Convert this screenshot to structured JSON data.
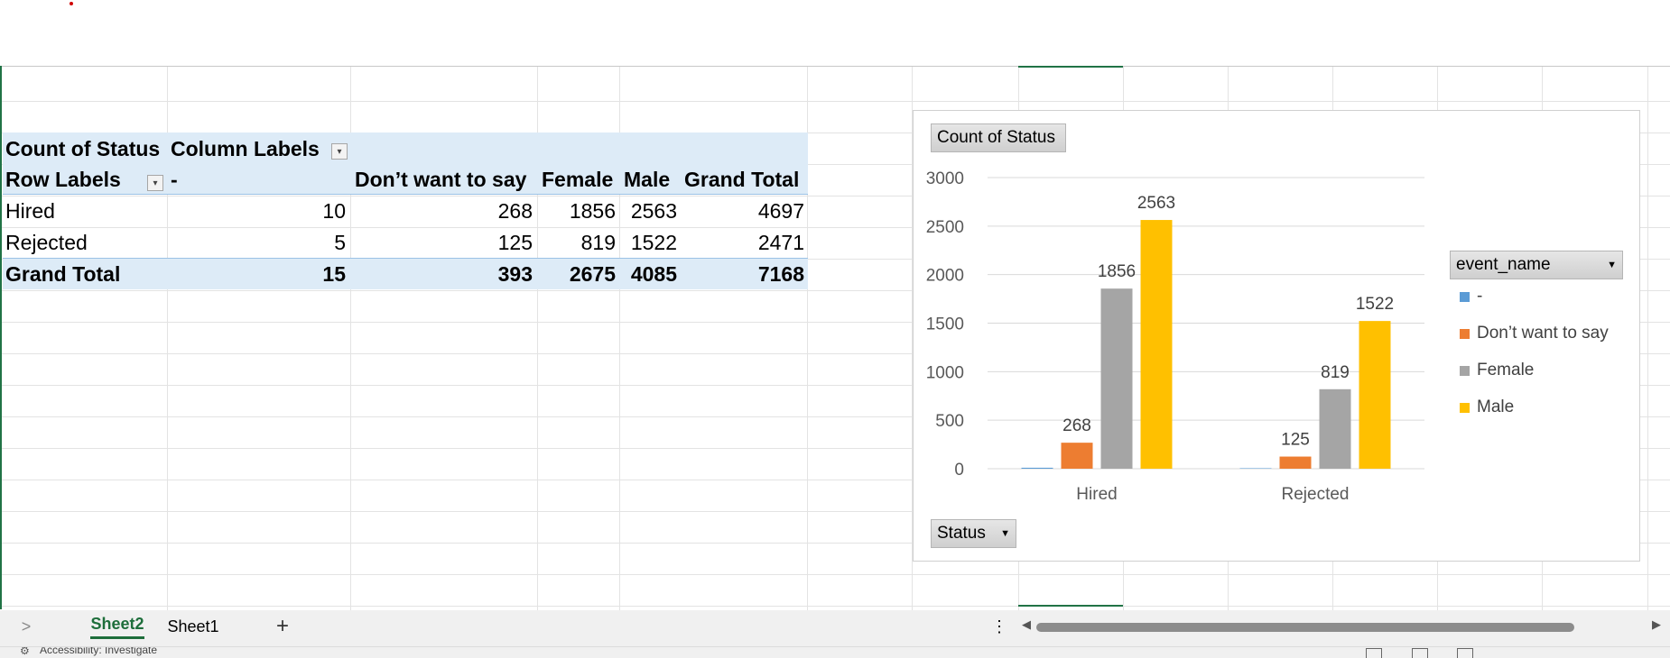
{
  "pivot": {
    "header_row1": {
      "c1": "Count of Status",
      "c2": "Column Labels"
    },
    "header_row2": {
      "c1": "Row Labels",
      "c2": "-",
      "c3": "Don’t want to say",
      "c4": "Female",
      "c5": "Male",
      "c6": "Grand Total"
    },
    "rows": [
      {
        "label": "Hired",
        "dash": "10",
        "dont": "268",
        "female": "1856",
        "male": "2563",
        "total": "4697"
      },
      {
        "label": "Rejected",
        "dash": "5",
        "dont": "125",
        "female": "819",
        "male": "1522",
        "total": "2471"
      }
    ],
    "grand": {
      "label": "Grand Total",
      "dash": "15",
      "dont": "393",
      "female": "2675",
      "male": "4085",
      "total": "7168"
    }
  },
  "chart": {
    "value_button": "Count of Status",
    "axis_button": "Status",
    "legend_button": "event_name",
    "colors": {
      "dash": "#5b9bd5",
      "dont": "#ed7d31",
      "female": "#a5a5a5",
      "male": "#ffc000",
      "grid": "#d9d9d9",
      "tick": "#595959"
    }
  },
  "chart_data": {
    "type": "bar",
    "categories": [
      "Hired",
      "Rejected"
    ],
    "series": [
      {
        "name": "-",
        "values": [
          10,
          5
        ]
      },
      {
        "name": "Don’t want to say",
        "values": [
          268,
          125
        ]
      },
      {
        "name": "Female",
        "values": [
          1856,
          819
        ]
      },
      {
        "name": "Male",
        "values": [
          2563,
          1522
        ]
      }
    ],
    "data_labels": [
      [
        "",
        ""
      ],
      [
        "268",
        "125"
      ],
      [
        "1856",
        "819"
      ],
      [
        "2563",
        "1522"
      ]
    ],
    "yticks": [
      "0",
      "500",
      "1000",
      "1500",
      "2000",
      "2500",
      "3000"
    ],
    "ylim": [
      0,
      3000
    ],
    "legend": "right",
    "grid": true
  },
  "tabs": {
    "nav_label": ">",
    "sheet2": "Sheet2",
    "sheet1": "Sheet1",
    "add_label": "+",
    "options_label": "⋮",
    "scroll_left": "◀",
    "scroll_right": "▶"
  },
  "status": {
    "text": "Accessibility: Investigate"
  }
}
